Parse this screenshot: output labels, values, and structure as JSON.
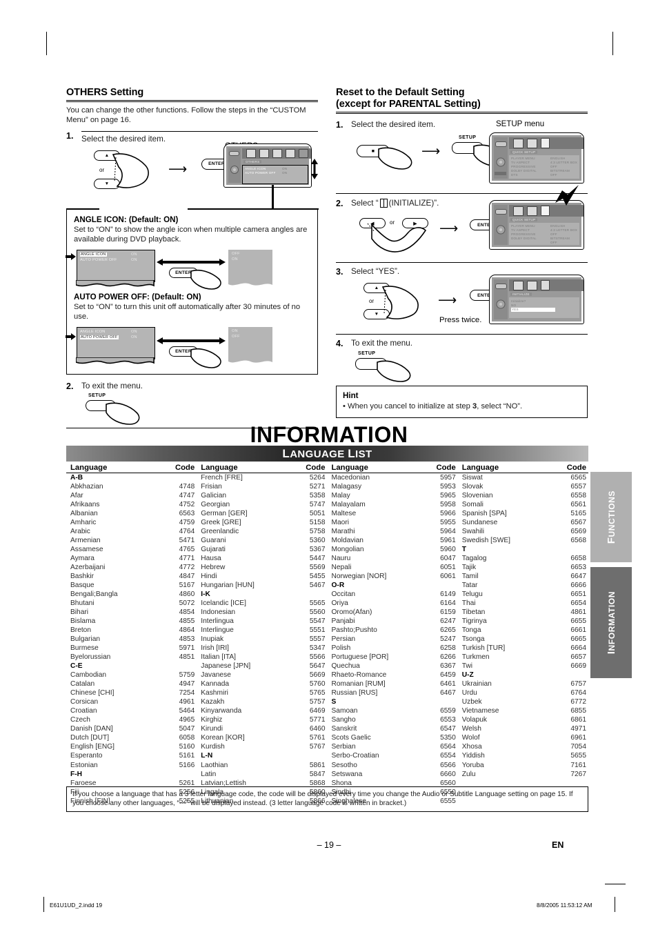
{
  "left_column": {
    "heading": "OTHERS Setting",
    "intro": "You can change the other functions. Follow the steps in the “CUSTOM Menu” on page 16.",
    "step1": {
      "num": "1.",
      "text": "Select the desired item.",
      "menu_caption": "OTHERS menu"
    },
    "keys": {
      "up": "▲",
      "down": "▼",
      "or": "or",
      "enter": "ENTER",
      "setup": "SETUP"
    },
    "osd_others": {
      "tab": "OTHERS",
      "rows": [
        {
          "label": "ANGLE ICON",
          "value": "ON"
        },
        {
          "label": "AUTO POWER OFF",
          "value": "ON"
        }
      ]
    },
    "detail_box": {
      "angle_icon": {
        "title": "ANGLE ICON: (Default: ON)",
        "desc": "Set to “ON” to show the angle icon when multiple camera angles are available during DVD playback.",
        "left_panel": [
          {
            "label": "ANGLE ICON",
            "value": "ON",
            "selected": true
          },
          {
            "label": "AUTO POWER OFF",
            "value": "ON",
            "selected": false
          }
        ],
        "right_panel": [
          "OFF",
          "ON"
        ]
      },
      "auto_power_off": {
        "title": "AUTO POWER OFF:  (Default: ON)",
        "desc": "Set to “ON” to turn this unit off automatically after 30 minutes of no use.",
        "left_panel": [
          {
            "label": "ANGLE ICON",
            "value": "ON",
            "selected": false
          },
          {
            "label": "AUTO POWER OFF",
            "value": "ON",
            "selected": true
          }
        ],
        "right_panel": [
          "ON",
          "OFF"
        ]
      }
    },
    "step2": {
      "num": "2.",
      "text": "To exit the menu.",
      "key": "SETUP"
    }
  },
  "right_column": {
    "heading_line1": "Reset to the Default Setting",
    "heading_line2": "(except for PARENTAL Setting)",
    "step1": {
      "num": "1.",
      "text": "Select the desired item.",
      "menu_caption": "SETUP menu",
      "key_stop": "STOP",
      "key_setup": "SETUP"
    },
    "osd_quicksetup": {
      "tab": "QUICK SETUP",
      "rows": [
        {
          "label": "PLAYER MENU",
          "value": "ENGLISH"
        },
        {
          "label": "TV ASPECT",
          "value": "4:3 LETTER BOX"
        },
        {
          "label": "PROGRESSIVE",
          "value": "OFF"
        },
        {
          "label": "DOLBY DIGITAL",
          "value": "BITSTREAM"
        },
        {
          "label": "DTS",
          "value": "OFF"
        }
      ]
    },
    "step2": {
      "num": "2.",
      "text": "Select “",
      "text_tail": " (INITIALIZE)”.",
      "key_left": "◀",
      "key_right": "▶",
      "or": "or",
      "enter": "ENTER"
    },
    "step3": {
      "num": "3.",
      "text": "Select “YES”.",
      "key_up": "▲",
      "key_down": "▼",
      "or": "or",
      "enter": "ENTER",
      "press_twice": "Press twice."
    },
    "osd_initialize": {
      "tab": "INITIALIZE",
      "rows": [
        "Initialize?",
        "NO",
        "YES"
      ],
      "selected": "YES"
    },
    "step4": {
      "num": "4.",
      "text": "To exit the menu.",
      "key": "SETUP"
    },
    "hint": {
      "title": "Hint",
      "text_a": "• When you cancel to initialize at step ",
      "bold": "3",
      "text_b": ", select “NO”."
    }
  },
  "information": {
    "title": "INFORMATION",
    "banner_first": "L",
    "banner_rest": "ANGUAGE ",
    "banner_first2": "L",
    "banner_rest2": "IST",
    "banner_plain": "LANGUAGE LIST",
    "note": "If you choose a language that has a 3 letter language code, the code will be displayed every time you change the Audio or Subtitle Language setting on page 15. If you choose any other languages, “---” will be displayed instead. (3 letter language code is written in bracket.)"
  },
  "language_table": {
    "headers": {
      "language": "Language",
      "code": "Code"
    },
    "columns": [
      [
        {
          "group": "A-B"
        },
        {
          "name": "Abkhazian",
          "code": "4748"
        },
        {
          "name": "Afar",
          "code": "4747"
        },
        {
          "name": "Afrikaans",
          "code": "4752"
        },
        {
          "name": "Albanian",
          "code": "6563"
        },
        {
          "name": "Amharic",
          "code": "4759"
        },
        {
          "name": "Arabic",
          "code": "4764"
        },
        {
          "name": "Armenian",
          "code": "5471"
        },
        {
          "name": "Assamese",
          "code": "4765"
        },
        {
          "name": "Aymara",
          "code": "4771"
        },
        {
          "name": "Azerbaijani",
          "code": "4772"
        },
        {
          "name": "Bashkir",
          "code": "4847"
        },
        {
          "name": "Basque",
          "code": "5167"
        },
        {
          "name": "Bengali;Bangla",
          "code": "4860"
        },
        {
          "name": "Bhutani",
          "code": "5072"
        },
        {
          "name": "Bihari",
          "code": "4854"
        },
        {
          "name": "Bislama",
          "code": "4855"
        },
        {
          "name": "Breton",
          "code": "4864"
        },
        {
          "name": "Bulgarian",
          "code": "4853"
        },
        {
          "name": "Burmese",
          "code": "5971"
        },
        {
          "name": "Byelorussian",
          "code": "4851"
        },
        {
          "group": "C-E"
        },
        {
          "name": "Cambodian",
          "code": "5759"
        },
        {
          "name": "Catalan",
          "code": "4947"
        },
        {
          "name": "Chinese [CHI]",
          "code": "7254"
        },
        {
          "name": "Corsican",
          "code": "4961"
        },
        {
          "name": "Croatian",
          "code": "5464"
        },
        {
          "name": "Czech",
          "code": "4965"
        },
        {
          "name": "Danish [DAN]",
          "code": "5047"
        },
        {
          "name": "Dutch [DUT]",
          "code": "6058"
        },
        {
          "name": "English [ENG]",
          "code": "5160"
        },
        {
          "name": "Esperanto",
          "code": "5161"
        },
        {
          "name": "Estonian",
          "code": "5166"
        },
        {
          "group": "F-H"
        },
        {
          "name": "Faroese",
          "code": "5261"
        },
        {
          "name": "Fiji",
          "code": "5256"
        },
        {
          "name": "Finnish [FIN]",
          "code": "5255"
        }
      ],
      [
        {
          "name": "French [FRE]",
          "code": "5264"
        },
        {
          "name": "Frisian",
          "code": "5271"
        },
        {
          "name": "Galician",
          "code": "5358"
        },
        {
          "name": "Georgian",
          "code": "5747"
        },
        {
          "name": "German [GER]",
          "code": "5051"
        },
        {
          "name": "Greek [GRE]",
          "code": "5158"
        },
        {
          "name": "Greenlandic",
          "code": "5758"
        },
        {
          "name": "Guarani",
          "code": "5360"
        },
        {
          "name": "Gujarati",
          "code": "5367"
        },
        {
          "name": "Hausa",
          "code": "5447"
        },
        {
          "name": "Hebrew",
          "code": "5569"
        },
        {
          "name": "Hindi",
          "code": "5455"
        },
        {
          "name": "Hungarian [HUN]",
          "code": "5467"
        },
        {
          "group": "I-K"
        },
        {
          "name": "Icelandic [ICE]",
          "code": "5565"
        },
        {
          "name": "Indonesian",
          "code": "5560"
        },
        {
          "name": "Interlingua",
          "code": "5547"
        },
        {
          "name": "Interlingue",
          "code": "5551"
        },
        {
          "name": "Inupiak",
          "code": "5557"
        },
        {
          "name": "Irish [IRI]",
          "code": "5347"
        },
        {
          "name": "Italian [ITA]",
          "code": "5566"
        },
        {
          "name": "Japanese [JPN]",
          "code": "5647"
        },
        {
          "name": "Javanese",
          "code": "5669"
        },
        {
          "name": "Kannada",
          "code": "5760"
        },
        {
          "name": "Kashmiri",
          "code": "5765"
        },
        {
          "name": "Kazakh",
          "code": "5757"
        },
        {
          "name": "Kinyarwanda",
          "code": "6469"
        },
        {
          "name": "Kirghiz",
          "code": "5771"
        },
        {
          "name": "Kirundi",
          "code": "6460"
        },
        {
          "name": "Korean [KOR]",
          "code": "5761"
        },
        {
          "name": "Kurdish",
          "code": "5767"
        },
        {
          "group": "L-N"
        },
        {
          "name": "Laothian",
          "code": "5861"
        },
        {
          "name": "Latin",
          "code": "5847"
        },
        {
          "name": "Latvian;Lettish",
          "code": "5868"
        },
        {
          "name": "Lingala",
          "code": "5860"
        },
        {
          "name": "Lithuanian",
          "code": "5866"
        }
      ],
      [
        {
          "name": "Macedonian",
          "code": "5957"
        },
        {
          "name": "Malagasy",
          "code": "5953"
        },
        {
          "name": "Malay",
          "code": "5965"
        },
        {
          "name": "Malayalam",
          "code": "5958"
        },
        {
          "name": "Maltese",
          "code": "5966"
        },
        {
          "name": "Maori",
          "code": "5955"
        },
        {
          "name": "Marathi",
          "code": "5964"
        },
        {
          "name": "Moldavian",
          "code": "5961"
        },
        {
          "name": "Mongolian",
          "code": "5960"
        },
        {
          "name": "Nauru",
          "code": "6047"
        },
        {
          "name": "Nepali",
          "code": "6051"
        },
        {
          "name": "Norwegian [NOR]",
          "code": "6061"
        },
        {
          "group": "O-R"
        },
        {
          "name": "Occitan",
          "code": "6149"
        },
        {
          "name": "Oriya",
          "code": "6164"
        },
        {
          "name": "Oromo(Afan)",
          "code": "6159"
        },
        {
          "name": "Panjabi",
          "code": "6247"
        },
        {
          "name": "Pashto;Pushto",
          "code": "6265"
        },
        {
          "name": "Persian",
          "code": "5247"
        },
        {
          "name": "Polish",
          "code": "6258"
        },
        {
          "name": "Portuguese [POR]",
          "code": "6266"
        },
        {
          "name": "Quechua",
          "code": "6367"
        },
        {
          "name": "Rhaeto-Romance",
          "code": "6459"
        },
        {
          "name": "Romanian [RUM]",
          "code": "6461"
        },
        {
          "name": "Russian [RUS]",
          "code": "6467"
        },
        {
          "group": "S"
        },
        {
          "name": "Samoan",
          "code": "6559"
        },
        {
          "name": "Sangho",
          "code": "6553"
        },
        {
          "name": "Sanskrit",
          "code": "6547"
        },
        {
          "name": "Scots Gaelic",
          "code": "5350"
        },
        {
          "name": "Serbian",
          "code": "6564"
        },
        {
          "name": "Serbo-Croatian",
          "code": "6554"
        },
        {
          "name": "Sesotho",
          "code": "6566"
        },
        {
          "name": "Setswana",
          "code": "6660"
        },
        {
          "name": "Shona",
          "code": "6560"
        },
        {
          "name": "Sindhi",
          "code": "6550"
        },
        {
          "name": "Singhalese",
          "code": "6555"
        }
      ],
      [
        {
          "name": "Siswat",
          "code": "6565"
        },
        {
          "name": "Slovak",
          "code": "6557"
        },
        {
          "name": "Slovenian",
          "code": "6558"
        },
        {
          "name": "Somali",
          "code": "6561"
        },
        {
          "name": "Spanish [SPA]",
          "code": "5165"
        },
        {
          "name": "Sundanese",
          "code": "6567"
        },
        {
          "name": "Swahili",
          "code": "6569"
        },
        {
          "name": "Swedish [SWE]",
          "code": "6568"
        },
        {
          "group": "T"
        },
        {
          "name": "Tagalog",
          "code": "6658"
        },
        {
          "name": "Tajik",
          "code": "6653"
        },
        {
          "name": "Tamil",
          "code": "6647"
        },
        {
          "name": "Tatar",
          "code": "6666"
        },
        {
          "name": "Telugu",
          "code": "6651"
        },
        {
          "name": "Thai",
          "code": "6654"
        },
        {
          "name": "Tibetan",
          "code": "4861"
        },
        {
          "name": "Tigrinya",
          "code": "6655"
        },
        {
          "name": "Tonga",
          "code": "6661"
        },
        {
          "name": "Tsonga",
          "code": "6665"
        },
        {
          "name": "Turkish [TUR]",
          "code": "6664"
        },
        {
          "name": "Turkmen",
          "code": "6657"
        },
        {
          "name": "Twi",
          "code": "6669"
        },
        {
          "group": "U-Z"
        },
        {
          "name": "Ukrainian",
          "code": "6757"
        },
        {
          "name": "Urdu",
          "code": "6764"
        },
        {
          "name": "Uzbek",
          "code": "6772"
        },
        {
          "name": "Vietnamese",
          "code": "6855"
        },
        {
          "name": "Volapuk",
          "code": "6861"
        },
        {
          "name": "Welsh",
          "code": "4971"
        },
        {
          "name": "Wolof",
          "code": "6961"
        },
        {
          "name": "Xhosa",
          "code": "7054"
        },
        {
          "name": "Yiddish",
          "code": "5655"
        },
        {
          "name": "Yoruba",
          "code": "7161"
        },
        {
          "name": "Zulu",
          "code": "7267"
        }
      ]
    ]
  },
  "side_tabs": [
    {
      "label": "FUNCTIONS",
      "color": "#b0b0b0"
    },
    {
      "label": "INFORMATION",
      "color": "#6e6e6e"
    }
  ],
  "footer": {
    "page_number": "– 19 –",
    "lang_mark": "EN",
    "print_left": "E61U1UD_2.indd   19",
    "print_right": "8/8/2005   11:53:12 AM"
  }
}
